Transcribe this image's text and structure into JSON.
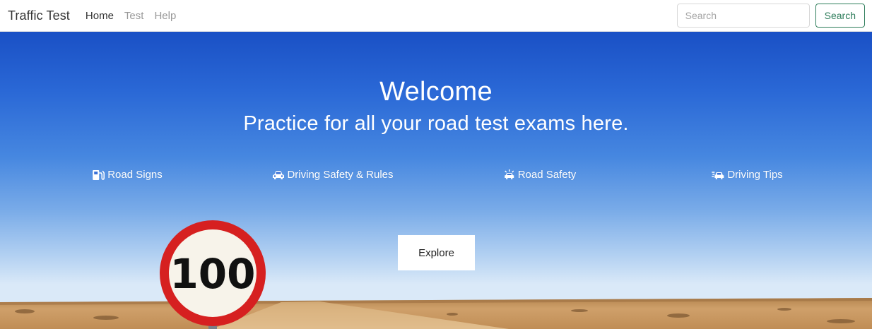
{
  "navbar": {
    "brand": "Traffic Test",
    "links": [
      {
        "label": "Home",
        "active": true
      },
      {
        "label": "Test",
        "active": false
      },
      {
        "label": "Help",
        "active": false
      }
    ],
    "search": {
      "placeholder": "Search",
      "value": "",
      "button_label": "Search"
    }
  },
  "hero": {
    "title": "Welcome",
    "subtitle": "Practice for all your road test exams here.",
    "features": [
      {
        "label": "Road Signs",
        "icon": "gas-pump-icon"
      },
      {
        "label": "Driving Safety & Rules",
        "icon": "car-icon"
      },
      {
        "label": "Road Safety",
        "icon": "car-crash-icon"
      },
      {
        "label": "Driving Tips",
        "icon": "car-tips-icon"
      }
    ],
    "explore_label": "Explore",
    "speed_sign_value": "100"
  },
  "colors": {
    "nav_accent": "#2e7d5b",
    "sky_top": "#1a50c5",
    "sky_horizon": "#dae9f8",
    "desert": "#c99a60",
    "sign_red": "#d62020"
  }
}
